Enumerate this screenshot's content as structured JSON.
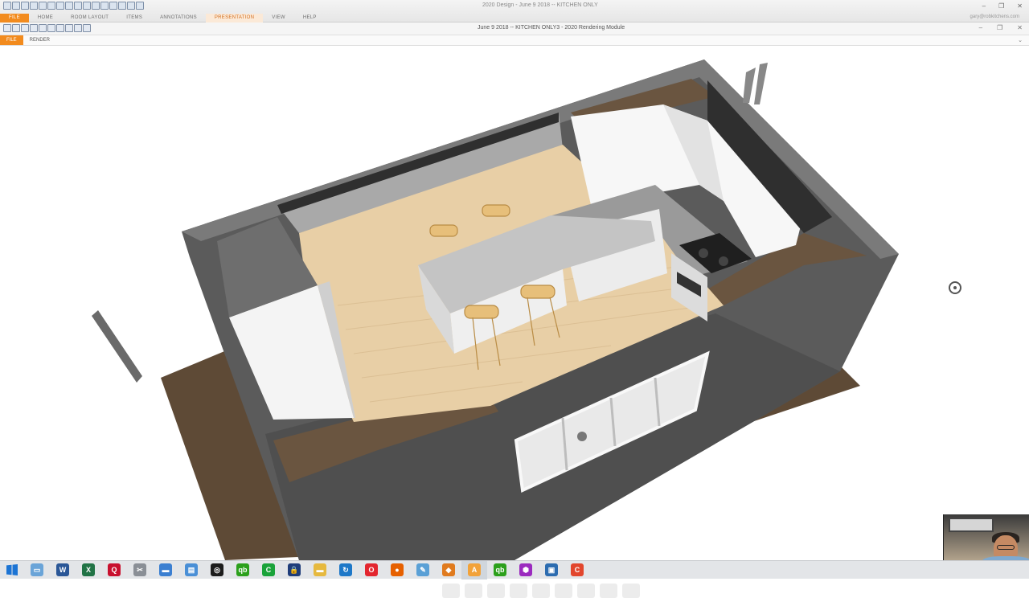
{
  "outer_window": {
    "title": "2020 Design - June 9 2018 -- KITCHEN ONLY",
    "ribbon_tabs": [
      "FILE",
      "HOME",
      "ROOM LAYOUT",
      "ITEMS",
      "ANNOTATIONS",
      "PRESENTATION",
      "VIEW",
      "HELP"
    ],
    "active_tab": "PRESENTATION",
    "user_email": "gary@robkitchens.com"
  },
  "render_window": {
    "title": "June 9 2018 -- KITCHEN ONLY3 - 2020 Rendering Module",
    "menu_tabs": [
      "FILE",
      "RENDER"
    ]
  },
  "controls": {
    "minimize": "–",
    "restore": "❐",
    "close": "✕",
    "collapse": "⌄"
  },
  "colors": {
    "accent": "#f28b1e",
    "wall": "#5b5b5b",
    "floor_wood": "#e8cfa6",
    "floor_outside": "#5e4a36",
    "countertop": "#bdbdbd"
  },
  "taskbar_icons": [
    {
      "name": "task-view-icon",
      "glyph": "▭",
      "color": "#6aa4d8"
    },
    {
      "name": "word-icon",
      "glyph": "W",
      "color": "#2b5797"
    },
    {
      "name": "excel-icon",
      "glyph": "X",
      "color": "#217346"
    },
    {
      "name": "quicken-icon",
      "glyph": "Q",
      "color": "#c8102e"
    },
    {
      "name": "tools-icon",
      "glyph": "✂",
      "color": "#8a8f96"
    },
    {
      "name": "explorer-icon",
      "glyph": "▬",
      "color": "#3b7fd1"
    },
    {
      "name": "notepad-icon",
      "glyph": "▤",
      "color": "#4a8fd6"
    },
    {
      "name": "camtasia-icon",
      "glyph": "◎",
      "color": "#1c1c1c"
    },
    {
      "name": "quickbooks-icon",
      "glyph": "qb",
      "color": "#2ca01c"
    },
    {
      "name": "camtasia-green-icon",
      "glyph": "C",
      "color": "#1aa33a"
    },
    {
      "name": "lock-app-icon",
      "glyph": "🔒",
      "color": "#1f3d7a"
    },
    {
      "name": "file-manager-icon",
      "glyph": "▬",
      "color": "#e6b93f"
    },
    {
      "name": "sync-icon",
      "glyph": "↻",
      "color": "#1e78c8"
    },
    {
      "name": "opera-icon",
      "glyph": "O",
      "color": "#e3262f"
    },
    {
      "name": "firefox-icon",
      "glyph": "●",
      "color": "#e66000"
    },
    {
      "name": "pen-icon",
      "glyph": "✎",
      "color": "#5aa0d6"
    },
    {
      "name": "design-icon",
      "glyph": "◆",
      "color": "#e07b1f"
    },
    {
      "name": "2020-design-icon",
      "glyph": "A",
      "color": "#f2a23a"
    },
    {
      "name": "quickbooks2-icon",
      "glyph": "qb",
      "color": "#2ca01c"
    },
    {
      "name": "gallery-icon",
      "glyph": "⬢",
      "color": "#9b2bbf"
    },
    {
      "name": "monitor-icon",
      "glyph": "▣",
      "color": "#2c6cb0"
    },
    {
      "name": "camtasia-rec-icon",
      "glyph": "C",
      "color": "#e2462d"
    }
  ],
  "active_taskbar_index": 17
}
